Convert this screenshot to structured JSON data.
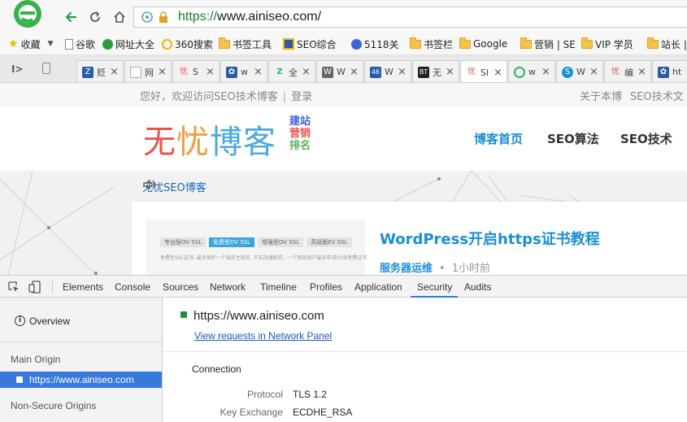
{
  "browser": {
    "url_scheme": "https://",
    "url_rest": "www.ainiseo.com/",
    "bookmarks": [
      {
        "label": "收藏",
        "icon": "star-icon"
      },
      {
        "label": "谷歌",
        "icon": "page-icon"
      },
      {
        "label": "网址大全",
        "icon": "site-icon"
      },
      {
        "label": "360搜索",
        "icon": "search-icon"
      },
      {
        "label": "书签工具",
        "icon": "folder-icon"
      },
      {
        "label": "SEO综合",
        "icon": "site-icon"
      },
      {
        "label": "5118关",
        "icon": "site-icon"
      },
      {
        "label": "书签栏",
        "icon": "folder-icon"
      },
      {
        "label": "Google",
        "icon": "folder-icon"
      },
      {
        "label": "营销 | SE",
        "icon": "folder-icon"
      },
      {
        "label": "VIP 学员",
        "icon": "folder-icon"
      },
      {
        "label": "站长 |",
        "icon": "folder-icon"
      }
    ],
    "tabs": [
      {
        "fav": "Z",
        "title": "贬",
        "color": "#2a5aa8"
      },
      {
        "fav": "",
        "title": "网",
        "color": "#cccccc"
      },
      {
        "fav": "忧",
        "title": "S",
        "color": "#ffffff"
      },
      {
        "fav": "🐾",
        "title": "w",
        "color": "#2a5aa8"
      },
      {
        "fav": "Z",
        "title": "全",
        "color": "#2bb673"
      },
      {
        "fav": "W",
        "title": "W",
        "color": "#666666"
      },
      {
        "fav": "46",
        "title": "W",
        "color": "#2a5aa8"
      },
      {
        "fav": "BT",
        "title": "无",
        "color": "#222222"
      },
      {
        "fav": "忧",
        "title": "Sl",
        "color": "#ffffff"
      },
      {
        "fav": "O",
        "title": "w",
        "color": "#2bb673"
      },
      {
        "fav": "S",
        "title": "W",
        "color": "#1a8fd6"
      },
      {
        "fav": "忧",
        "title": "编",
        "color": "#ffffff"
      },
      {
        "fav": "🐾",
        "title": "ht",
        "color": "#2a5aa8"
      }
    ],
    "tab_close": "×"
  },
  "site": {
    "greeting": "您好，欢迎访问SEO技术博客",
    "sep": "|",
    "login": "登录",
    "top_right": [
      "关于本博",
      "SEO技术文"
    ],
    "logo_text": "无忧博客",
    "logo_side": [
      "建站",
      "营销",
      "排名"
    ],
    "nav": [
      "博客首页",
      "SEO算法",
      "SEO技术"
    ],
    "notice": "无忧SEO博客",
    "thumb_tabs": [
      "专业版OV SSL",
      "免费型DV SSL",
      "增强型OV SSL",
      "高级版EV SSL"
    ],
    "thumb_caption": "免费型SSL证书, 最多保护一个域名主域名, 不支持通配符，一个网站用户最多申请20张免费证书",
    "post_title": "WordPress开启https证书教程",
    "post_category": "服务器运维",
    "post_dot": "•",
    "post_time": "1小时前"
  },
  "devtools": {
    "tabs": [
      "Elements",
      "Console",
      "Sources",
      "Network",
      "Timeline",
      "Profiles",
      "Application",
      "Security",
      "Audits"
    ],
    "active_tab": "Security",
    "sidebar": {
      "overview": "Overview",
      "main_origin_header": "Main Origin",
      "main_origin": "https://www.ainiseo.com",
      "non_secure_header": "Non-Secure Origins"
    },
    "main": {
      "origin": "https://www.ainiseo.com",
      "view_requests": "View requests in Network Panel",
      "connection_header": "Connection",
      "rows": [
        {
          "key": "Protocol",
          "value": "TLS 1.2"
        },
        {
          "key": "Key Exchange",
          "value": "ECDHE_RSA"
        }
      ]
    }
  },
  "colors": {
    "accent": "#1a8fd6",
    "devtools_selection": "#3879d9",
    "secure_green": "#1e8e3e",
    "logo_colors": [
      "#e8554e",
      "#f19c38",
      "#4aa9e0",
      "#5bb35b"
    ]
  }
}
